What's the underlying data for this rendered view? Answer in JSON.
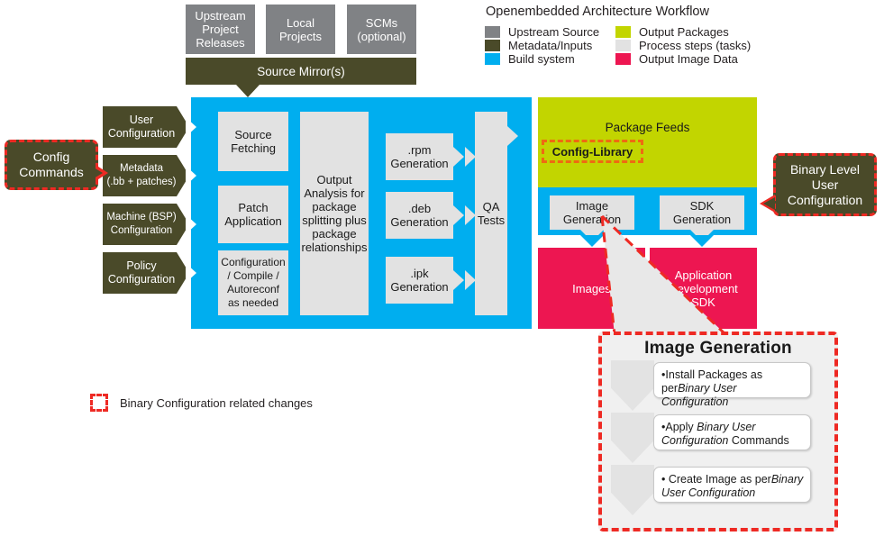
{
  "legend": {
    "title": "Openembedded Architecture Workflow",
    "entries_left": [
      {
        "label": "Upstream Source",
        "color": "#808285"
      },
      {
        "label": "Metadata/Inputs",
        "color": "#4a4a29"
      },
      {
        "label": "Build system",
        "color": "#00aeef"
      }
    ],
    "entries_right": [
      {
        "label": "Output Packages",
        "color": "#c2d500"
      },
      {
        "label": "Process steps (tasks)",
        "color": "#e2e2e2"
      },
      {
        "label": "Output Image Data",
        "color": "#ed1651"
      }
    ]
  },
  "sources": [
    {
      "label": "Upstream\nProject\nReleases"
    },
    {
      "label": "Local\nProjects"
    },
    {
      "label": "SCMs\n(optional)"
    }
  ],
  "source_mirror": "Source Mirror(s)",
  "inputs": [
    {
      "label": "User\nConfiguration"
    },
    {
      "label": "Metadata\n(.bb + patches)"
    },
    {
      "label": "Machine (BSP)\nConfiguration"
    },
    {
      "label": "Policy\nConfiguration"
    }
  ],
  "callouts": {
    "config_commands": "Config\nCommands",
    "binary_level_user_config": "Binary Level\nUser\nConfiguration"
  },
  "build": {
    "steps_col1": [
      {
        "label": "Source\nFetching"
      },
      {
        "label": "Patch\nApplication"
      },
      {
        "label": "Configuration\n/ Compile /\nAutoreconf\nas needed"
      }
    ],
    "analysis": "Output\nAnalysis for\npackage\nsplitting plus\npackage\nrelationships",
    "generation": [
      {
        "label": ".rpm\nGeneration"
      },
      {
        "label": ".deb\nGeneration"
      },
      {
        "label": ".ipk\nGeneration"
      }
    ],
    "qa": "QA\nTests"
  },
  "feeds": {
    "title": "Package Feeds",
    "highlight": "Config-Library"
  },
  "outputs": {
    "image_generation": "Image\nGeneration",
    "sdk_generation": "SDK\nGeneration",
    "images": "Images",
    "app_dev_sdk": "Application\nDevelopment\nSDK"
  },
  "image_generation_panel": {
    "title": "Image Generation",
    "items": [
      {
        "bullet": "•",
        "plain1": "Install Packages as per",
        "italic": "Binary User Configuration",
        "plain2": ""
      },
      {
        "bullet": "•",
        "plain1": "Apply ",
        "italic": "Binary User Configuration",
        "plain2": " Commands"
      },
      {
        "bullet": "•",
        "plain1": " Create Image as per",
        "italic": "Binary User Configuration",
        "plain2": ""
      }
    ]
  },
  "key": {
    "label": "Binary Configuration related  changes"
  }
}
